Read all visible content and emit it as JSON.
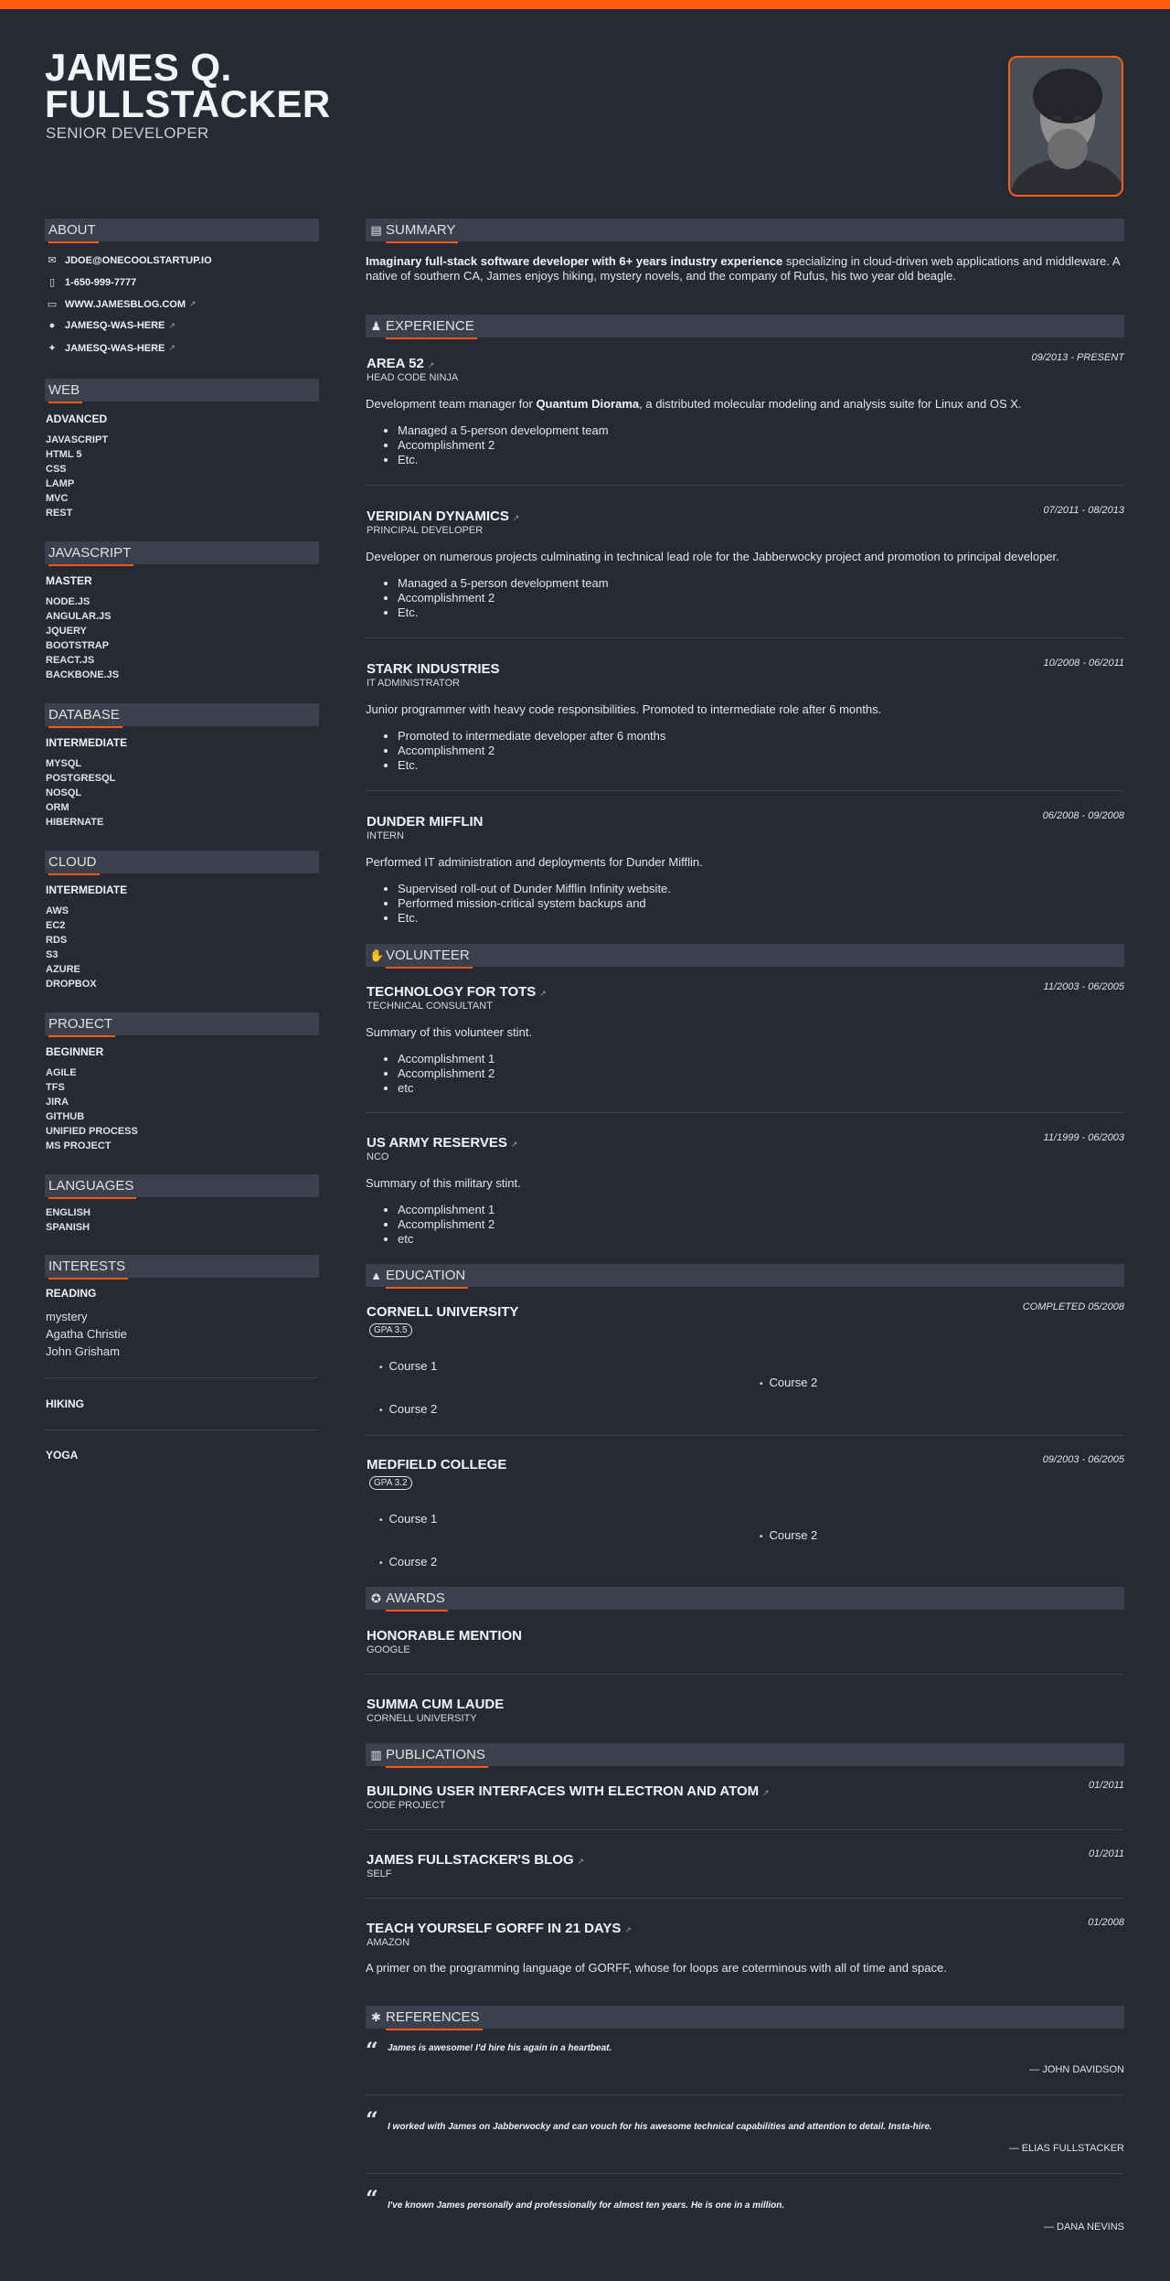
{
  "header": {
    "name_line1": "JAMES Q.",
    "name_line2": "FULLSTACKER",
    "title": "SENIOR DEVELOPER",
    "accent_color": "#ff5b11"
  },
  "sections": {
    "about": "ABOUT",
    "summary": "SUMMARY",
    "experience": "EXPERIENCE",
    "volunteer": "VOLUNTEER",
    "education": "EDUCATION",
    "awards": "AWARDS",
    "publications": "PUBLICATIONS",
    "references": "REFERENCES",
    "languages": "LANGUAGES",
    "interests": "INTERESTS"
  },
  "about": {
    "email": "JDOE@ONECOOLSTARTUP.IO",
    "phone": "1-650-999-7777",
    "website": "WWW.JAMESBLOG.COM",
    "github": "JAMESQ-WAS-HERE",
    "twitter": "JAMESQ-WAS-HERE"
  },
  "skills": [
    {
      "name": "WEB",
      "level": "ADVANCED",
      "keywords": [
        "JAVASCRIPT",
        "HTML 5",
        "CSS",
        "LAMP",
        "MVC",
        "REST"
      ]
    },
    {
      "name": "JAVASCRIPT",
      "level": "MASTER",
      "keywords": [
        "NODE.JS",
        "ANGULAR.JS",
        "JQUERY",
        "BOOTSTRAP",
        "REACT.JS",
        "BACKBONE.JS"
      ]
    },
    {
      "name": "DATABASE",
      "level": "INTERMEDIATE",
      "keywords": [
        "MYSQL",
        "POSTGRESQL",
        "NOSQL",
        "ORM",
        "HIBERNATE"
      ]
    },
    {
      "name": "CLOUD",
      "level": "INTERMEDIATE",
      "keywords": [
        "AWS",
        "EC2",
        "RDS",
        "S3",
        "AZURE",
        "DROPBOX"
      ]
    },
    {
      "name": "PROJECT",
      "level": "BEGINNER",
      "keywords": [
        "AGILE",
        "TFS",
        "JIRA",
        "GITHUB",
        "UNIFIED PROCESS",
        "MS PROJECT"
      ]
    }
  ],
  "languages": [
    "ENGLISH",
    "SPANISH"
  ],
  "interests": [
    {
      "name": "READING",
      "keywords": [
        "mystery",
        "Agatha Christie",
        "John Grisham"
      ]
    },
    {
      "name": "HIKING"
    },
    {
      "name": "YOGA"
    }
  ],
  "summary": {
    "bold": "Imaginary full-stack software developer with 6+ years industry experience",
    "rest": " specializing in cloud-driven web applications and middleware. A native of southern CA, James enjoys hiking, mystery novels, and the company of Rufus, his two year old beagle."
  },
  "experience": [
    {
      "company": "AREA 52",
      "position": "HEAD CODE NINJA",
      "dates": "09/2013 - PRESENT",
      "desc_pre": "Development team manager for ",
      "desc_bold": "Quantum Diorama",
      "desc_post": ", a distributed molecular modeling and analysis suite for Linux and OS X.",
      "highlights": [
        "Managed a 5-person development team",
        "Accomplishment 2",
        "Etc."
      ]
    },
    {
      "company": "VERIDIAN DYNAMICS",
      "position": "PRINCIPAL DEVELOPER",
      "dates": "07/2011 - 08/2013",
      "desc": "Developer on numerous projects culminating in technical lead role for the Jabberwocky project and promotion to principal developer.",
      "highlights": [
        "Managed a 5-person development team",
        "Accomplishment 2",
        "Etc."
      ]
    },
    {
      "company": "STARK INDUSTRIES",
      "position": "IT ADMINISTRATOR",
      "dates": "10/2008 - 06/2011",
      "desc": "Junior programmer with heavy code responsibilities. Promoted to intermediate role after 6 months.",
      "highlights": [
        "Promoted to intermediate developer after 6 months",
        "Accomplishment 2",
        "Etc."
      ]
    },
    {
      "company": "DUNDER MIFFLIN",
      "position": "INTERN",
      "dates": "06/2008 - 09/2008",
      "desc": "Performed IT administration and deployments for Dunder Mifflin.",
      "highlights": [
        "Supervised roll-out of Dunder Mifflin Infinity website.",
        "Performed mission-critical system backups and",
        "Etc."
      ]
    }
  ],
  "volunteer": [
    {
      "org": "TECHNOLOGY FOR TOTS",
      "position": "TECHNICAL CONSULTANT",
      "dates": "11/2003 - 06/2005",
      "desc": "Summary of this volunteer stint.",
      "highlights": [
        "Accomplishment 1",
        "Accomplishment 2",
        "etc"
      ]
    },
    {
      "org": "US ARMY RESERVES",
      "position": "NCO",
      "dates": "11/1999 - 06/2003",
      "desc": "Summary of this military stint.",
      "highlights": [
        "Accomplishment 1",
        "Accomplishment 2",
        "etc"
      ]
    }
  ],
  "education": [
    {
      "school": "CORNELL UNIVERSITY",
      "dates": "COMPLETED 05/2008",
      "gpa": "GPA 3.5",
      "courses": [
        "Course 1",
        "Course 2",
        "Course 2"
      ]
    },
    {
      "school": "MEDFIELD COLLEGE",
      "dates": "09/2003 - 06/2005",
      "gpa": "GPA 3.2",
      "courses": [
        "Course 1",
        "Course 2",
        "Course 2"
      ]
    }
  ],
  "awards": [
    {
      "title": "HONORABLE MENTION",
      "awarder": "GOOGLE"
    },
    {
      "title": "SUMMA CUM LAUDE",
      "awarder": "CORNELL UNIVERSITY"
    }
  ],
  "publications": [
    {
      "name": "BUILDING USER INTERFACES WITH ELECTRON AND ATOM",
      "publisher": "CODE PROJECT",
      "date": "01/2011"
    },
    {
      "name": "JAMES FULLSTACKER'S BLOG",
      "publisher": "SELF",
      "date": "01/2011"
    },
    {
      "name": "TEACH YOURSELF GORFF IN 21 DAYS",
      "publisher": "AMAZON",
      "date": "01/2008",
      "summary": "A primer on the programming language of GORFF, whose for loops are coterminous with all of time and space."
    }
  ],
  "references": [
    {
      "quote": "James is awesome! I'd hire his again in a heartbeat.",
      "name": "— JOHN DAVIDSON"
    },
    {
      "quote": "I worked with James on Jabberwocky and can vouch for his awesome technical capabilities and attention to detail. Insta-hire.",
      "name": "— ELIAS FULLSTACKER"
    },
    {
      "quote": "I've known James personally and professionally for almost ten years. He is one in a million.",
      "name": "— DANA NEVINS"
    }
  ]
}
